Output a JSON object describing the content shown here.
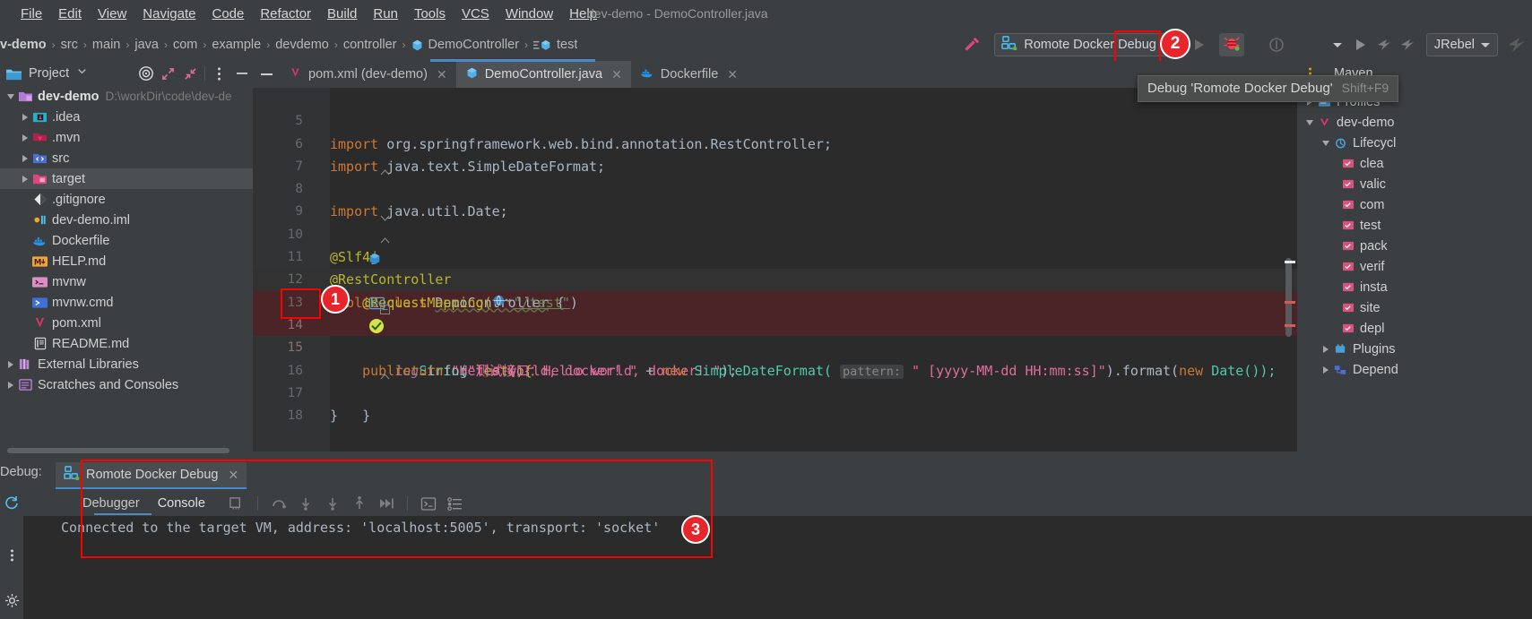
{
  "window": {
    "title": "dev-demo - DemoController.java"
  },
  "menubar": {
    "items": [
      {
        "label": "File",
        "mnemonic": "F"
      },
      {
        "label": "Edit",
        "mnemonic": "E"
      },
      {
        "label": "View",
        "mnemonic": "V"
      },
      {
        "label": "Navigate",
        "mnemonic": "N"
      },
      {
        "label": "Code",
        "mnemonic": "C"
      },
      {
        "label": "Refactor",
        "mnemonic": "R"
      },
      {
        "label": "Build",
        "mnemonic": "B"
      },
      {
        "label": "Run",
        "mnemonic": "u"
      },
      {
        "label": "Tools",
        "mnemonic": "T"
      },
      {
        "label": "VCS",
        "mnemonic": "S"
      },
      {
        "label": "Window",
        "mnemonic": "W"
      },
      {
        "label": "Help",
        "mnemonic": "H"
      }
    ]
  },
  "breadcrumb": {
    "items": [
      "v-demo",
      "src",
      "main",
      "java",
      "com",
      "example",
      "devdemo",
      "controller",
      "DemoController",
      "test"
    ]
  },
  "toolbar": {
    "run_config": "Romote Docker Debug",
    "jrebel": "JRebel",
    "debug_tooltip": {
      "text": "Debug 'Romote Docker Debug'",
      "shortcut": "Shift+F9"
    }
  },
  "annotations": [
    {
      "number": "1",
      "target": "breakpoint-gutter-line-14"
    },
    {
      "number": "2",
      "target": "debug-toolbar-button"
    },
    {
      "number": "3",
      "target": "console-connected-message"
    }
  ],
  "project_panel": {
    "title": "Project",
    "root": {
      "name": "dev-demo",
      "path": "D:\\workDir\\code\\dev-de"
    },
    "items": [
      {
        "label": ".idea",
        "icon": "idea-folder-icon",
        "expandable": true,
        "indent": 1,
        "selected": false
      },
      {
        "label": ".mvn",
        "icon": "mvn-folder-icon",
        "expandable": true,
        "indent": 1,
        "selected": false
      },
      {
        "label": "src",
        "icon": "src-folder-icon",
        "expandable": true,
        "indent": 1,
        "selected": false
      },
      {
        "label": "target",
        "icon": "target-folder-icon",
        "expandable": true,
        "indent": 1,
        "selected": true
      },
      {
        "label": ".gitignore",
        "icon": "git-icon",
        "expandable": false,
        "indent": 1,
        "selected": false
      },
      {
        "label": "dev-demo.iml",
        "icon": "iml-icon",
        "expandable": false,
        "indent": 1,
        "selected": false
      },
      {
        "label": "Dockerfile",
        "icon": "docker-icon",
        "expandable": false,
        "indent": 1,
        "selected": false
      },
      {
        "label": "HELP.md",
        "icon": "markdown-icon",
        "expandable": false,
        "indent": 1,
        "selected": false
      },
      {
        "label": "mvnw",
        "icon": "shell-icon",
        "expandable": false,
        "indent": 1,
        "selected": false
      },
      {
        "label": "mvnw.cmd",
        "icon": "cmd-icon",
        "expandable": false,
        "indent": 1,
        "selected": false
      },
      {
        "label": "pom.xml",
        "icon": "maven-icon",
        "expandable": false,
        "indent": 1,
        "selected": false
      },
      {
        "label": "README.md",
        "icon": "readme-icon",
        "expandable": false,
        "indent": 1,
        "selected": false
      },
      {
        "label": "External Libraries",
        "icon": "libraries-icon",
        "expandable": true,
        "indent": 0,
        "selected": false
      },
      {
        "label": "Scratches and Consoles",
        "icon": "scratches-icon",
        "expandable": true,
        "indent": 0,
        "selected": false
      }
    ]
  },
  "editor": {
    "tabs": [
      {
        "label": "pom.xml (dev-demo)",
        "icon": "maven-icon",
        "active": false
      },
      {
        "label": "DemoController.java",
        "icon": "java-class-icon",
        "active": true
      },
      {
        "label": "Dockerfile",
        "icon": "docker-icon",
        "active": false
      }
    ],
    "lines": [
      {
        "num": "5",
        "state": "normal"
      },
      {
        "num": "6",
        "state": "normal"
      },
      {
        "num": "7",
        "state": "normal"
      },
      {
        "num": "8",
        "state": "normal"
      },
      {
        "num": "9",
        "state": "normal"
      },
      {
        "num": "10",
        "state": "normal"
      },
      {
        "num": "11",
        "state": "normal"
      },
      {
        "num": "12",
        "state": "normal"
      },
      {
        "num": "13",
        "state": "current"
      },
      {
        "num": "14",
        "state": "breakpoint"
      },
      {
        "num": "15",
        "state": "normal"
      },
      {
        "num": "16",
        "state": "normal"
      },
      {
        "num": "17",
        "state": "normal"
      },
      {
        "num": "18",
        "state": "normal"
      }
    ],
    "code_text": {
      "l5": "import org.springframework.web.bind.annotation.RestController;",
      "l6": "import java.text.SimpleDateFormat;",
      "l7": "import java.util.Date;",
      "l9": "@Slf4j",
      "l10": "@RestController",
      "l11": "public class DemoController {",
      "l12": "@RequestMapping(\"/test\")",
      "l13": "public String test(){",
      "l14": "log.info(\"测试接口：Hello world, docker! \");",
      "l15": "return \"Hello world, docker! \" + new SimpleDateFormat( pattern: \" [yyyy-MM-dd HH:mm:ss]\").format(new Date());",
      "l16": "}",
      "l17": "}"
    },
    "tokens": {
      "import": "import",
      "pkg_rest": "org.springframework.web.bind.annotation.RestController;",
      "pkg_sdf": "java.text.SimpleDateFormat;",
      "pkg_date": "java.util.Date;",
      "at_slf4j": "@Slf4j",
      "at_restcontroller": "@RestController",
      "public": "public",
      "class": "class",
      "democontroller": "DemoController",
      "brace_open": "{",
      "brace_close": "}",
      "at_requestmapping": "@RequestMapping(",
      "str_test": "\"/test\"",
      "paren_close": ")",
      "string_type": "String",
      "test_sig": "test(){",
      "log": "log",
      "dot_info": ".info(",
      "log_str": "\"测试接口：Hello world, docker! \"",
      "semi_paren": ");",
      "return": "return",
      "hello_str": "\"Hello world, docker! \"",
      "plus": "+",
      "new": "new",
      "sdf": "SimpleDateFormat(",
      "hint_pattern": "pattern:",
      "pattern_str": "\" [yyyy-MM-dd HH:mm:ss]\"",
      "format": ").format(",
      "date": "Date());"
    }
  },
  "maven_panel": {
    "title": "Maven",
    "items": [
      {
        "label": "Profiles",
        "indent": 0,
        "expandable": true,
        "icon": "profiles-icon"
      },
      {
        "label": "dev-demo",
        "indent": 0,
        "expandable": true,
        "icon": "maven-project-icon",
        "expanded": true
      },
      {
        "label": "Lifecycl",
        "indent": 1,
        "expandable": true,
        "icon": "lifecycle-icon",
        "expanded": true
      },
      {
        "label": "clea",
        "indent": 2,
        "expandable": false,
        "icon": "goal-icon"
      },
      {
        "label": "valic",
        "indent": 2,
        "expandable": false,
        "icon": "goal-icon"
      },
      {
        "label": "com",
        "indent": 2,
        "expandable": false,
        "icon": "goal-icon"
      },
      {
        "label": "test",
        "indent": 2,
        "expandable": false,
        "icon": "goal-icon"
      },
      {
        "label": "pack",
        "indent": 2,
        "expandable": false,
        "icon": "goal-icon"
      },
      {
        "label": "verif",
        "indent": 2,
        "expandable": false,
        "icon": "goal-icon"
      },
      {
        "label": "insta",
        "indent": 2,
        "expandable": false,
        "icon": "goal-icon"
      },
      {
        "label": "site",
        "indent": 2,
        "expandable": false,
        "icon": "goal-icon"
      },
      {
        "label": "depl",
        "indent": 2,
        "expandable": false,
        "icon": "goal-icon"
      },
      {
        "label": "Plugins",
        "indent": 1,
        "expandable": true,
        "icon": "plugins-icon"
      },
      {
        "label": "Depend",
        "indent": 1,
        "expandable": true,
        "icon": "dependencies-icon"
      }
    ]
  },
  "debug_panel": {
    "label": "Debug:",
    "session_tab": "Romote Docker Debug",
    "sub_tabs": [
      {
        "label": "Debugger",
        "active": false
      },
      {
        "label": "Console",
        "active": true
      }
    ],
    "console_output": "Connected to the target VM, address: 'localhost:5005', transport: 'socket'"
  },
  "colors": {
    "bg": "#3c3f41",
    "editor_bg": "#2b2b2b",
    "accent_blue": "#4a88c7",
    "annotation_red": "#ff0000",
    "badge_red": "#e8252a",
    "breakpoint_line": "#4a2427"
  }
}
